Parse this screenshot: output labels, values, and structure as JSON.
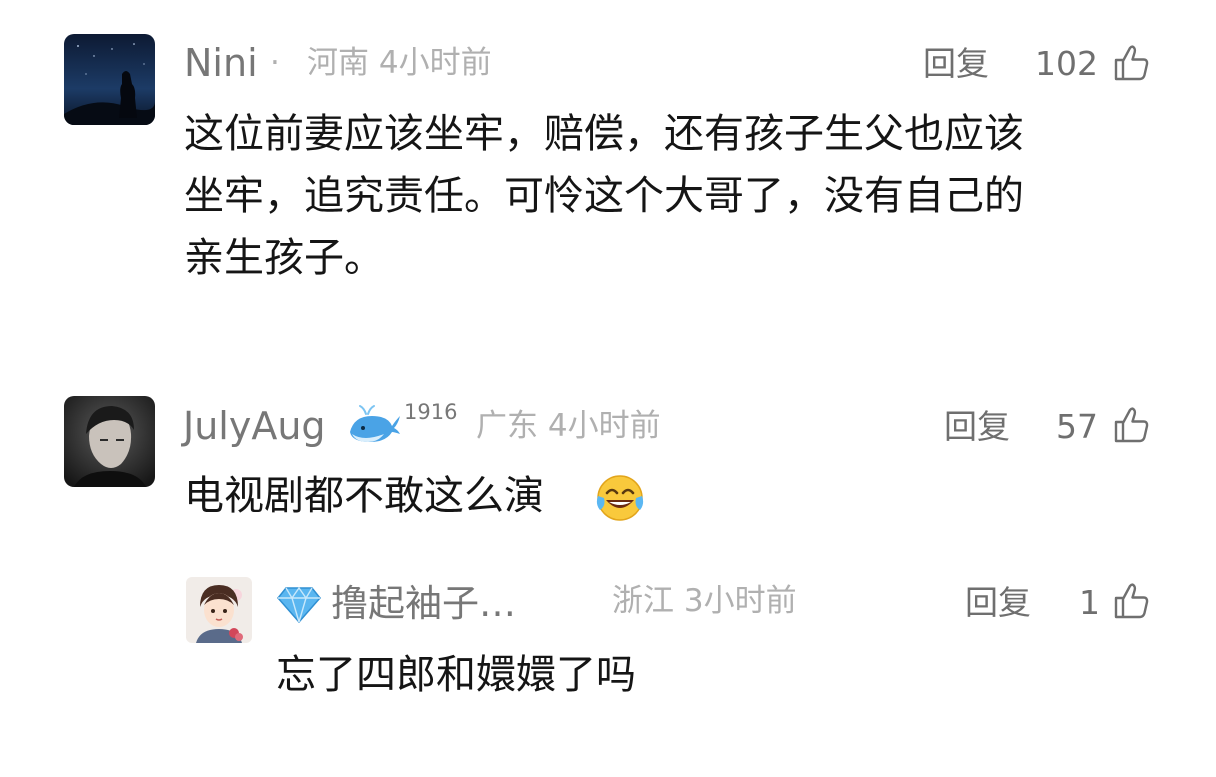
{
  "comments": [
    {
      "user": "Nini",
      "separator": "·",
      "location_time": "河南 4小时前",
      "reply_label": "回复",
      "likes": "102",
      "text_lines": [
        "这位前妻应该坐牢，赔偿，还有孩子生父也应该",
        "坐牢，追究责任。可怜这个大哥了，没有自己的",
        "亲生孩子。"
      ]
    },
    {
      "user": "JulyAug",
      "badge_number": "1916",
      "badge_icon": "whale-icon",
      "location_time": "广东 4小时前",
      "reply_label": "回复",
      "likes": "57",
      "text": "电视剧都不敢这么演",
      "emoji": "laughing-tears-emoji"
    },
    {
      "user_icon": "diamond-icon",
      "user": "撸起袖子…",
      "location_time": "浙江 3小时前",
      "reply_label": "回复",
      "likes": "1",
      "text": "忘了四郎和嬛嬛了吗"
    }
  ],
  "icons": {
    "like": "thumbs-up-icon"
  },
  "colors": {
    "username": "#777777",
    "meta": "#b0b0b0",
    "body_text": "#151515",
    "whale": "#4aa3e6",
    "diamond": "#5ab6f0"
  }
}
